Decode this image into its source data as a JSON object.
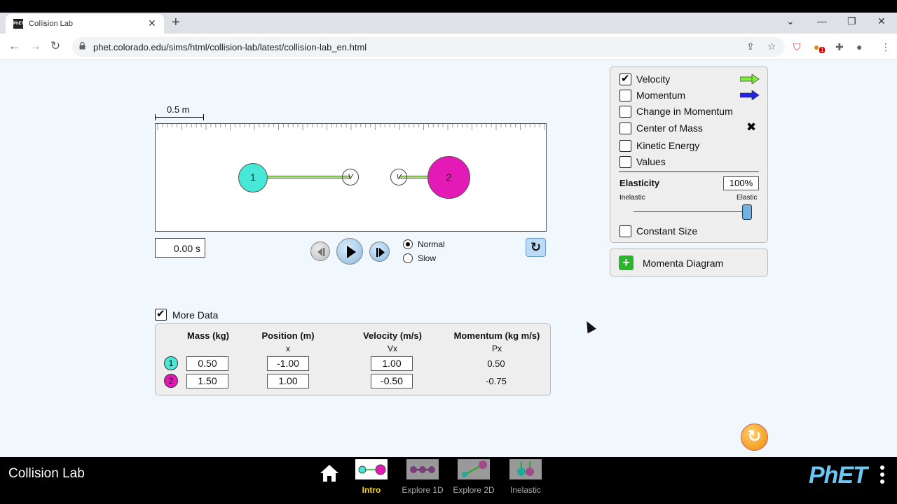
{
  "browser": {
    "tab_title": "Collision Lab",
    "favicon_text": "PhET",
    "url": "phet.colorado.edu/sims/html/collision-lab/latest/collision-lab_en.html",
    "extension_badge": "1"
  },
  "scale": {
    "label": "0.5 m"
  },
  "play_area": {
    "balls": [
      {
        "number": "1",
        "color": "#48e8d8"
      },
      {
        "number": "2",
        "color": "#e41ab7"
      }
    ],
    "velocity_handle_label": "V"
  },
  "time": {
    "value": "0.00 s"
  },
  "speed": {
    "normal": "Normal",
    "slow": "Slow",
    "selected": "Normal"
  },
  "options": {
    "items": [
      {
        "label": "Velocity",
        "checked": true
      },
      {
        "label": "Momentum",
        "checked": false
      },
      {
        "label": "Change in Momentum",
        "checked": false
      },
      {
        "label": "Center of Mass",
        "checked": false
      },
      {
        "label": "Kinetic Energy",
        "checked": false
      },
      {
        "label": "Values",
        "checked": false
      }
    ],
    "elasticity_title": "Elasticity",
    "elasticity_value": "100%",
    "elasticity_fraction": 1.0,
    "inelastic_label": "Inelastic",
    "elastic_label": "Elastic",
    "constant_size": "Constant Size",
    "colors": {
      "velocity": "#7ef03b",
      "momentum": "#2222ee"
    }
  },
  "momenta_diagram": {
    "label": "Momenta Diagram"
  },
  "more_data": {
    "label": "More Data",
    "checked": true,
    "headers": {
      "mass": "Mass (kg)",
      "position": "Position (m)",
      "position_sub": "x",
      "velocity": "Velocity (m/s)",
      "velocity_sub": "Vx",
      "momentum": "Momentum (kg m/s)",
      "momentum_sub": "Px"
    },
    "rows": [
      {
        "ball": "1",
        "mass": "0.50",
        "position": "-1.00",
        "velocity": "1.00",
        "momentum": "0.50"
      },
      {
        "ball": "2",
        "mass": "1.50",
        "position": "1.00",
        "velocity": "-0.50",
        "momentum": "-0.75"
      }
    ]
  },
  "navbar": {
    "sim_title": "Collision Lab",
    "screens": [
      {
        "label": "Intro",
        "active": true
      },
      {
        "label": "Explore 1D",
        "active": false
      },
      {
        "label": "Explore 2D",
        "active": false
      },
      {
        "label": "Inelastic",
        "active": false
      }
    ],
    "logo": "PhET"
  }
}
